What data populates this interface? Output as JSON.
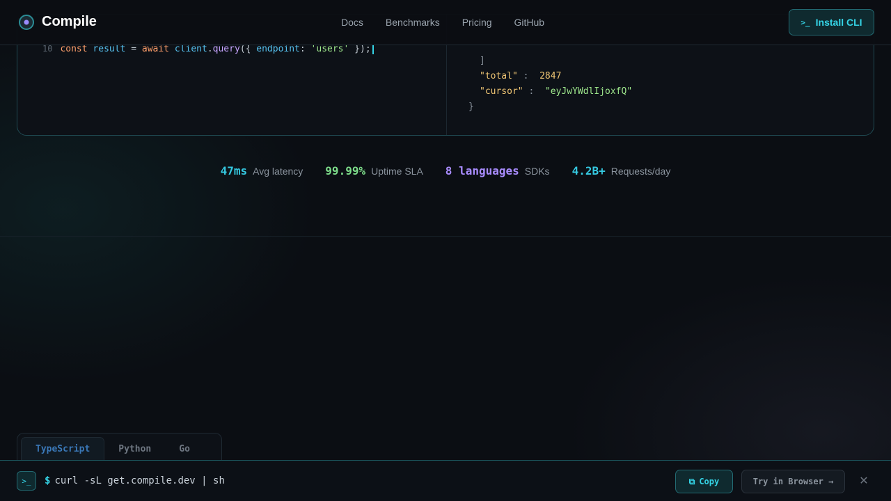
{
  "header": {
    "brand": "Compile",
    "nav": [
      "Docs",
      "Benchmarks",
      "Pricing",
      "GitHub"
    ],
    "install_label": "Install CLI"
  },
  "code": {
    "line_number": "10",
    "tokens": {
      "const": "const",
      "result": "result",
      "eq": " = ",
      "await": "await",
      "client": "client",
      "dot": ".",
      "query": "query",
      "open": "({ ",
      "endpoint": "endpoint",
      "colon": ": ",
      "users": "'users'",
      "close": " });"
    }
  },
  "response": {
    "bracket_close": "]",
    "total_key": "\"total\"",
    "total_value": "2847",
    "cursor_key": "\"cursor\"",
    "cursor_value": "\"eyJwYWdlIjoxfQ\"",
    "brace_close": "}"
  },
  "stats": [
    {
      "value": "47ms",
      "label": "Avg latency",
      "color": "#35c8e0"
    },
    {
      "value": "99.99%",
      "label": "Uptime SLA",
      "color": "#7ddc8a"
    },
    {
      "value": "8 languages",
      "label": "SDKs",
      "color": "#a98cff"
    },
    {
      "value": "4.2B+",
      "label": "Requests/day",
      "color": "#35c8e0"
    }
  ],
  "tabs": [
    "TypeScript",
    "Python",
    "Go"
  ],
  "active_tab": "TypeScript",
  "bottombar": {
    "prompt": "$",
    "command": "curl -sL get.compile.dev | sh",
    "copy_label": "Copy",
    "try_label": "Try in Browser →"
  },
  "icons": {
    "logo": "compile-logo-icon",
    "terminal": "terminal-icon",
    "copy": "copy-icon",
    "close": "close-icon"
  },
  "colors": {
    "accent": "#35d4e6",
    "background": "#0b0e13"
  }
}
